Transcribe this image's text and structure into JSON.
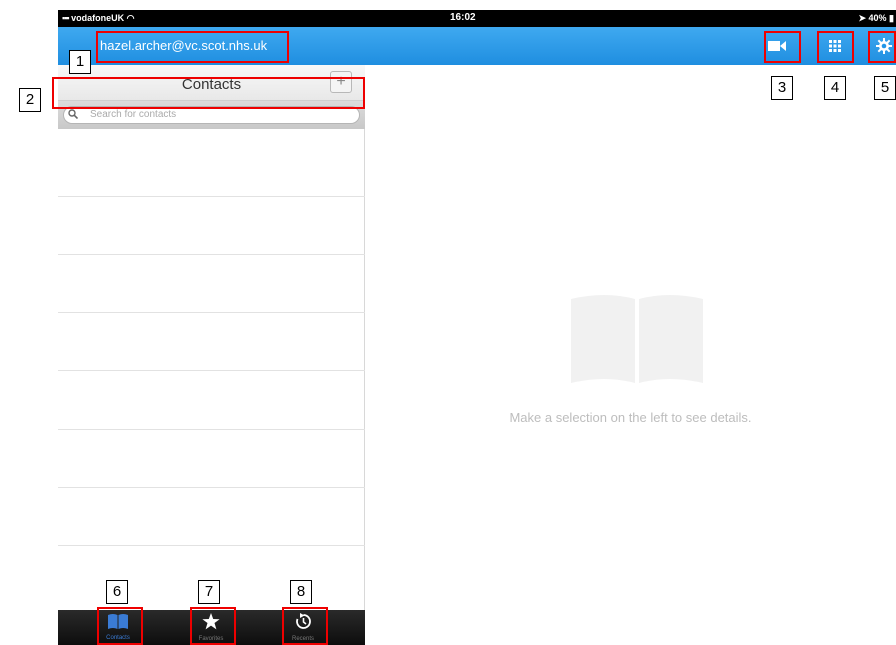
{
  "status_bar": {
    "carrier": "vodafoneUK",
    "time": "16:02",
    "battery": "40%"
  },
  "nav": {
    "account": "hazel.archer@vc.scot.nhs.uk"
  },
  "contacts": {
    "title": "Contacts",
    "add_label": "+",
    "search_placeholder": "Search for contacts"
  },
  "tabs": [
    {
      "label": "Contacts",
      "icon": "book-icon",
      "active": true
    },
    {
      "label": "Favorites",
      "icon": "star-icon",
      "active": false
    },
    {
      "label": "Recents",
      "icon": "recents-icon",
      "active": false
    }
  ],
  "detail": {
    "message": "Make a selection on the left to see details."
  },
  "callouts": [
    "1",
    "2",
    "3",
    "4",
    "5",
    "6",
    "7",
    "8"
  ],
  "colors": {
    "nav_blue": "#2196e8",
    "callout_red": "#e00000"
  }
}
